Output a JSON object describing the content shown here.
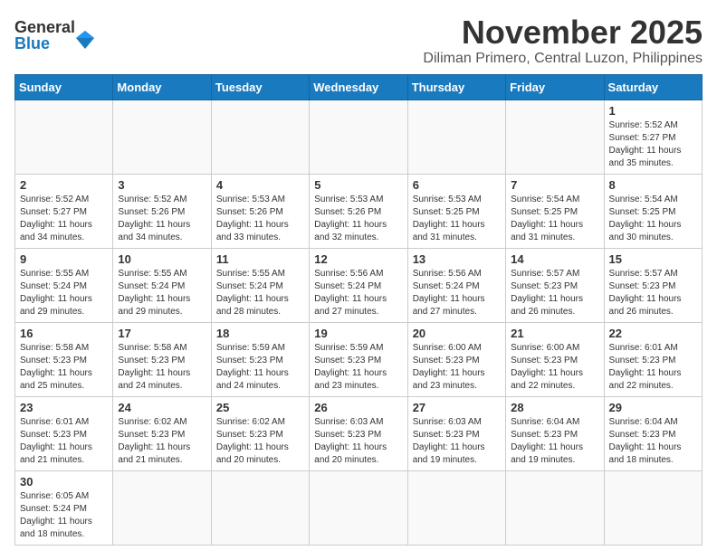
{
  "header": {
    "logo_general": "General",
    "logo_blue": "Blue",
    "month_title": "November 2025",
    "location": "Diliman Primero, Central Luzon, Philippines"
  },
  "weekdays": [
    "Sunday",
    "Monday",
    "Tuesday",
    "Wednesday",
    "Thursday",
    "Friday",
    "Saturday"
  ],
  "days": {
    "d1": {
      "num": "1",
      "sunrise": "5:52 AM",
      "sunset": "5:27 PM",
      "daylight": "11 hours and 35 minutes."
    },
    "d2": {
      "num": "2",
      "sunrise": "5:52 AM",
      "sunset": "5:27 PM",
      "daylight": "11 hours and 34 minutes."
    },
    "d3": {
      "num": "3",
      "sunrise": "5:52 AM",
      "sunset": "5:26 PM",
      "daylight": "11 hours and 34 minutes."
    },
    "d4": {
      "num": "4",
      "sunrise": "5:53 AM",
      "sunset": "5:26 PM",
      "daylight": "11 hours and 33 minutes."
    },
    "d5": {
      "num": "5",
      "sunrise": "5:53 AM",
      "sunset": "5:26 PM",
      "daylight": "11 hours and 32 minutes."
    },
    "d6": {
      "num": "6",
      "sunrise": "5:53 AM",
      "sunset": "5:25 PM",
      "daylight": "11 hours and 31 minutes."
    },
    "d7": {
      "num": "7",
      "sunrise": "5:54 AM",
      "sunset": "5:25 PM",
      "daylight": "11 hours and 31 minutes."
    },
    "d8": {
      "num": "8",
      "sunrise": "5:54 AM",
      "sunset": "5:25 PM",
      "daylight": "11 hours and 30 minutes."
    },
    "d9": {
      "num": "9",
      "sunrise": "5:55 AM",
      "sunset": "5:24 PM",
      "daylight": "11 hours and 29 minutes."
    },
    "d10": {
      "num": "10",
      "sunrise": "5:55 AM",
      "sunset": "5:24 PM",
      "daylight": "11 hours and 29 minutes."
    },
    "d11": {
      "num": "11",
      "sunrise": "5:55 AM",
      "sunset": "5:24 PM",
      "daylight": "11 hours and 28 minutes."
    },
    "d12": {
      "num": "12",
      "sunrise": "5:56 AM",
      "sunset": "5:24 PM",
      "daylight": "11 hours and 27 minutes."
    },
    "d13": {
      "num": "13",
      "sunrise": "5:56 AM",
      "sunset": "5:24 PM",
      "daylight": "11 hours and 27 minutes."
    },
    "d14": {
      "num": "14",
      "sunrise": "5:57 AM",
      "sunset": "5:23 PM",
      "daylight": "11 hours and 26 minutes."
    },
    "d15": {
      "num": "15",
      "sunrise": "5:57 AM",
      "sunset": "5:23 PM",
      "daylight": "11 hours and 26 minutes."
    },
    "d16": {
      "num": "16",
      "sunrise": "5:58 AM",
      "sunset": "5:23 PM",
      "daylight": "11 hours and 25 minutes."
    },
    "d17": {
      "num": "17",
      "sunrise": "5:58 AM",
      "sunset": "5:23 PM",
      "daylight": "11 hours and 24 minutes."
    },
    "d18": {
      "num": "18",
      "sunrise": "5:59 AM",
      "sunset": "5:23 PM",
      "daylight": "11 hours and 24 minutes."
    },
    "d19": {
      "num": "19",
      "sunrise": "5:59 AM",
      "sunset": "5:23 PM",
      "daylight": "11 hours and 23 minutes."
    },
    "d20": {
      "num": "20",
      "sunrise": "6:00 AM",
      "sunset": "5:23 PM",
      "daylight": "11 hours and 23 minutes."
    },
    "d21": {
      "num": "21",
      "sunrise": "6:00 AM",
      "sunset": "5:23 PM",
      "daylight": "11 hours and 22 minutes."
    },
    "d22": {
      "num": "22",
      "sunrise": "6:01 AM",
      "sunset": "5:23 PM",
      "daylight": "11 hours and 22 minutes."
    },
    "d23": {
      "num": "23",
      "sunrise": "6:01 AM",
      "sunset": "5:23 PM",
      "daylight": "11 hours and 21 minutes."
    },
    "d24": {
      "num": "24",
      "sunrise": "6:02 AM",
      "sunset": "5:23 PM",
      "daylight": "11 hours and 21 minutes."
    },
    "d25": {
      "num": "25",
      "sunrise": "6:02 AM",
      "sunset": "5:23 PM",
      "daylight": "11 hours and 20 minutes."
    },
    "d26": {
      "num": "26",
      "sunrise": "6:03 AM",
      "sunset": "5:23 PM",
      "daylight": "11 hours and 20 minutes."
    },
    "d27": {
      "num": "27",
      "sunrise": "6:03 AM",
      "sunset": "5:23 PM",
      "daylight": "11 hours and 19 minutes."
    },
    "d28": {
      "num": "28",
      "sunrise": "6:04 AM",
      "sunset": "5:23 PM",
      "daylight": "11 hours and 19 minutes."
    },
    "d29": {
      "num": "29",
      "sunrise": "6:04 AM",
      "sunset": "5:23 PM",
      "daylight": "11 hours and 18 minutes."
    },
    "d30": {
      "num": "30",
      "sunrise": "6:05 AM",
      "sunset": "5:24 PM",
      "daylight": "11 hours and 18 minutes."
    }
  }
}
